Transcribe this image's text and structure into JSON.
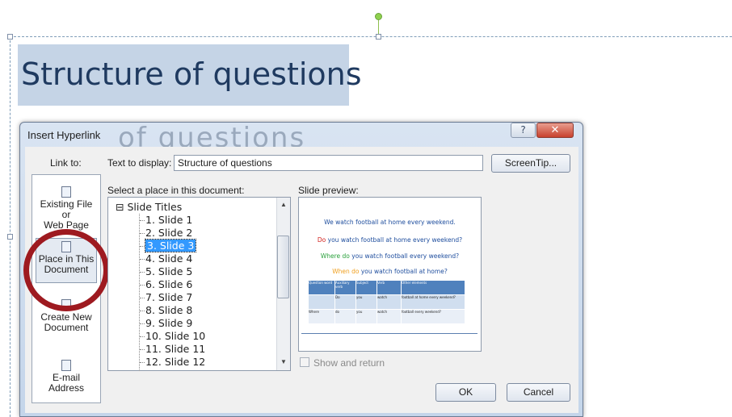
{
  "slide": {
    "title": "Structure of questions",
    "ghost_title": "of questions"
  },
  "dialog": {
    "title": "Insert Hyperlink",
    "help_label": "?",
    "close_label": "✕",
    "link_to_label": "Link to:",
    "text_to_display_label": "Text to display:",
    "text_to_display_value": "Structure of questions",
    "screentip_label": "ScreenTip...",
    "select_place_label": "Select a place in this document:",
    "slide_preview_label": "Slide preview:",
    "show_and_return_label": "Show and return",
    "ok_label": "OK",
    "cancel_label": "Cancel"
  },
  "link_to": [
    {
      "line1": "Existing File or",
      "line2": "Web Page",
      "icon": "globe-file-icon"
    },
    {
      "line1": "Place in This",
      "line2": "Document",
      "icon": "document-place-icon",
      "selected": true
    },
    {
      "line1": "Create New",
      "line2": "Document",
      "icon": "new-document-icon"
    },
    {
      "line1": "E-mail Address",
      "line2": "",
      "icon": "email-icon"
    }
  ],
  "tree": {
    "root": "Slide Titles",
    "items": [
      "1. Slide 1",
      "2. Slide 2",
      "3. Slide 3",
      "4. Slide 4",
      "5. Slide 5",
      "6. Slide 6",
      "7. Slide 7",
      "8. Slide 8",
      "9. Slide 9",
      "10. Slide 10",
      "11. Slide 11",
      "12. Slide 12"
    ],
    "selected_index": 2
  },
  "preview": {
    "line1": "We watch football at home every weekend.",
    "line2_hl": "Do",
    "line2_rest": " you watch football at home every weekend?",
    "line3_hl": "Where do",
    "line3_rest": " you watch football every weekend?",
    "line4_hl": "When do",
    "line4_rest": " you watch football at home?",
    "table_headers": [
      "Question word",
      "Auxiliary verb",
      "Subject",
      "Verb",
      "Other elements"
    ],
    "table_rows": [
      [
        "",
        "Do",
        "you",
        "watch",
        "football at home every weekend?"
      ],
      [
        "Where",
        "do",
        "you",
        "watch",
        "football every weekend?"
      ]
    ]
  },
  "colors": {
    "preview_blue": "#1f4e9e",
    "preview_red": "#d2201c",
    "preview_green": "#2aa13c",
    "preview_orange": "#f0a020",
    "highlight_ring": "#9e1a20"
  }
}
